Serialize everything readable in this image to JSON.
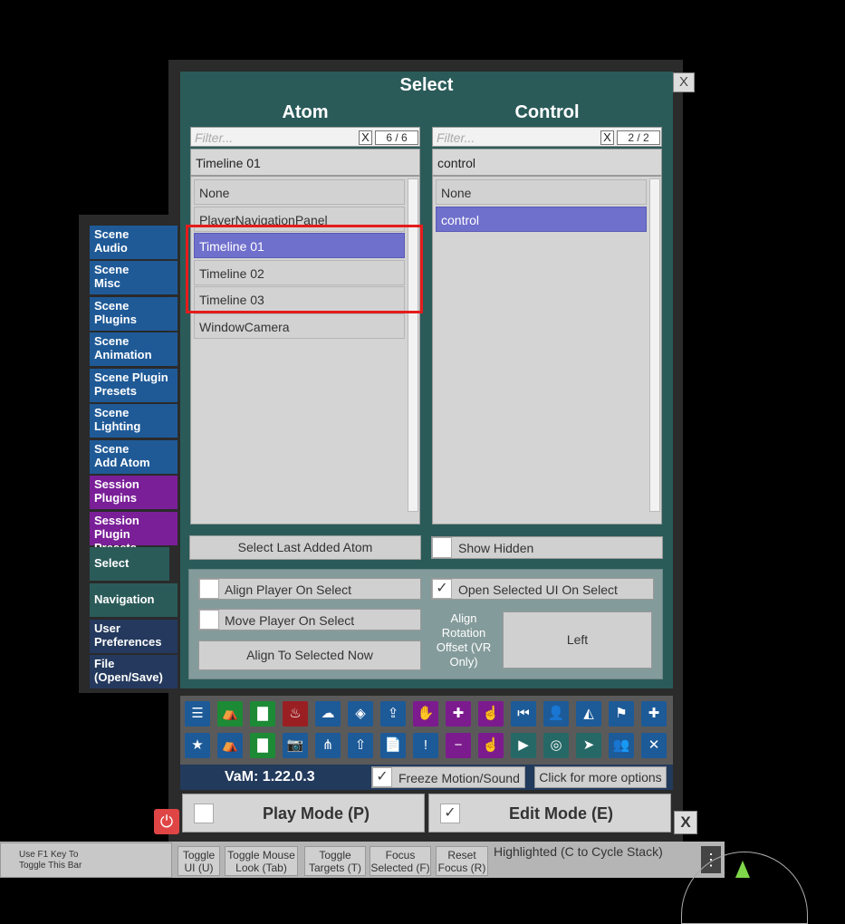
{
  "select_panel": {
    "title": "Select",
    "close_label": "X",
    "atom": {
      "header": "Atom",
      "filter_placeholder": "Filter...",
      "filter_clear": "X",
      "filter_count": "6 / 6",
      "selected_value": "Timeline 01",
      "items": [
        "None",
        "PlayerNavigationPanel",
        "Timeline 01",
        "Timeline 02",
        "Timeline 03",
        "WindowCamera"
      ]
    },
    "control": {
      "header": "Control",
      "filter_placeholder": "Filter...",
      "filter_clear": "X",
      "filter_count": "2 / 2",
      "selected_value": "control",
      "items": [
        "None",
        "control"
      ]
    },
    "select_last_added_label": "Select Last Added Atom",
    "show_hidden_label": "Show Hidden",
    "align_player_label": "Align Player On Select",
    "open_selected_ui_label": "Open Selected UI On Select",
    "move_player_label": "Move Player On Select",
    "align_rotation_label": "Align Rotation Offset (VR Only)",
    "align_rotation_value": "Left",
    "align_now_label": "Align To Selected Now"
  },
  "side_tabs": [
    {
      "line1": "Scene",
      "line2": "Audio"
    },
    {
      "line1": "Scene",
      "line2": "Misc"
    },
    {
      "line1": "Scene",
      "line2": "Plugins"
    },
    {
      "line1": "Scene",
      "line2": "Animation"
    },
    {
      "line1": "Scene Plugin",
      "line2": "Presets"
    },
    {
      "line1": "Scene",
      "line2": "Lighting"
    },
    {
      "line1": "Scene",
      "line2": "Add Atom"
    },
    {
      "line1": "Session",
      "line2": "Plugins"
    },
    {
      "line1": "Session Plugin",
      "line2": "Presets"
    },
    {
      "line1": "Select",
      "line2": ""
    },
    {
      "line1": "Navigation",
      "line2": ""
    },
    {
      "line1": "User",
      "line2": "Preferences"
    },
    {
      "line1": "File",
      "line2": "(Open/Save)"
    }
  ],
  "toolbar": {
    "row1": [
      "☰",
      "⛺",
      "▇",
      "♨",
      "☁",
      "◈",
      "⇪",
      "✋",
      "✚",
      "☝",
      "⏮",
      "👤",
      "◭",
      "⚑",
      "✚"
    ],
    "row2": [
      "★",
      "⛺",
      "▇",
      "📷",
      "⋔",
      "⇧",
      "📄",
      "!",
      "−",
      "☝",
      "▶",
      "◎",
      "➤",
      "👥",
      "✕"
    ],
    "icon_names_row1": [
      "menu-icon",
      "open-scene-icon",
      "folder-icon",
      "save-icon",
      "cloud-icon",
      "package-icon",
      "upload-icon",
      "hand-icon",
      "add-person-icon",
      "touch-icon",
      "skip-back-icon",
      "person-icon",
      "unity-icon",
      "flag-icon",
      "plus-icon"
    ],
    "icon_names_row2": [
      "star-icon",
      "open-template-icon",
      "folder-plugin-icon",
      "camera-icon",
      "hub-icon",
      "box-icon",
      "document-icon",
      "alert-icon",
      "remove-person-icon",
      "grab-icon",
      "play-icon",
      "target-icon",
      "pointer-icon",
      "people-icon",
      "tools-icon"
    ]
  },
  "version": "VaM: 1.22.0.3",
  "freeze_label": "Freeze Motion/Sound",
  "more_options_label": "Click for more options",
  "play_mode_label": "Play Mode (P)",
  "edit_mode_label": "Edit Mode (E)",
  "bottom_close": "X",
  "bottom_bar": {
    "hint": "Use F1 Key To Toggle This Bar",
    "toggle_ui": "Toggle UI (U)",
    "toggle_mouse": "Toggle Mouse Look (Tab)",
    "toggle_targets": "Toggle Targets (T)",
    "focus_selected": "Focus Selected (F)",
    "reset_focus": "Reset Focus (R)",
    "highlighted": "Highlighted (C to Cycle Stack)"
  },
  "colors": {
    "highlight_box": "#e41c1c",
    "selected_item": "#6f6fcc"
  }
}
